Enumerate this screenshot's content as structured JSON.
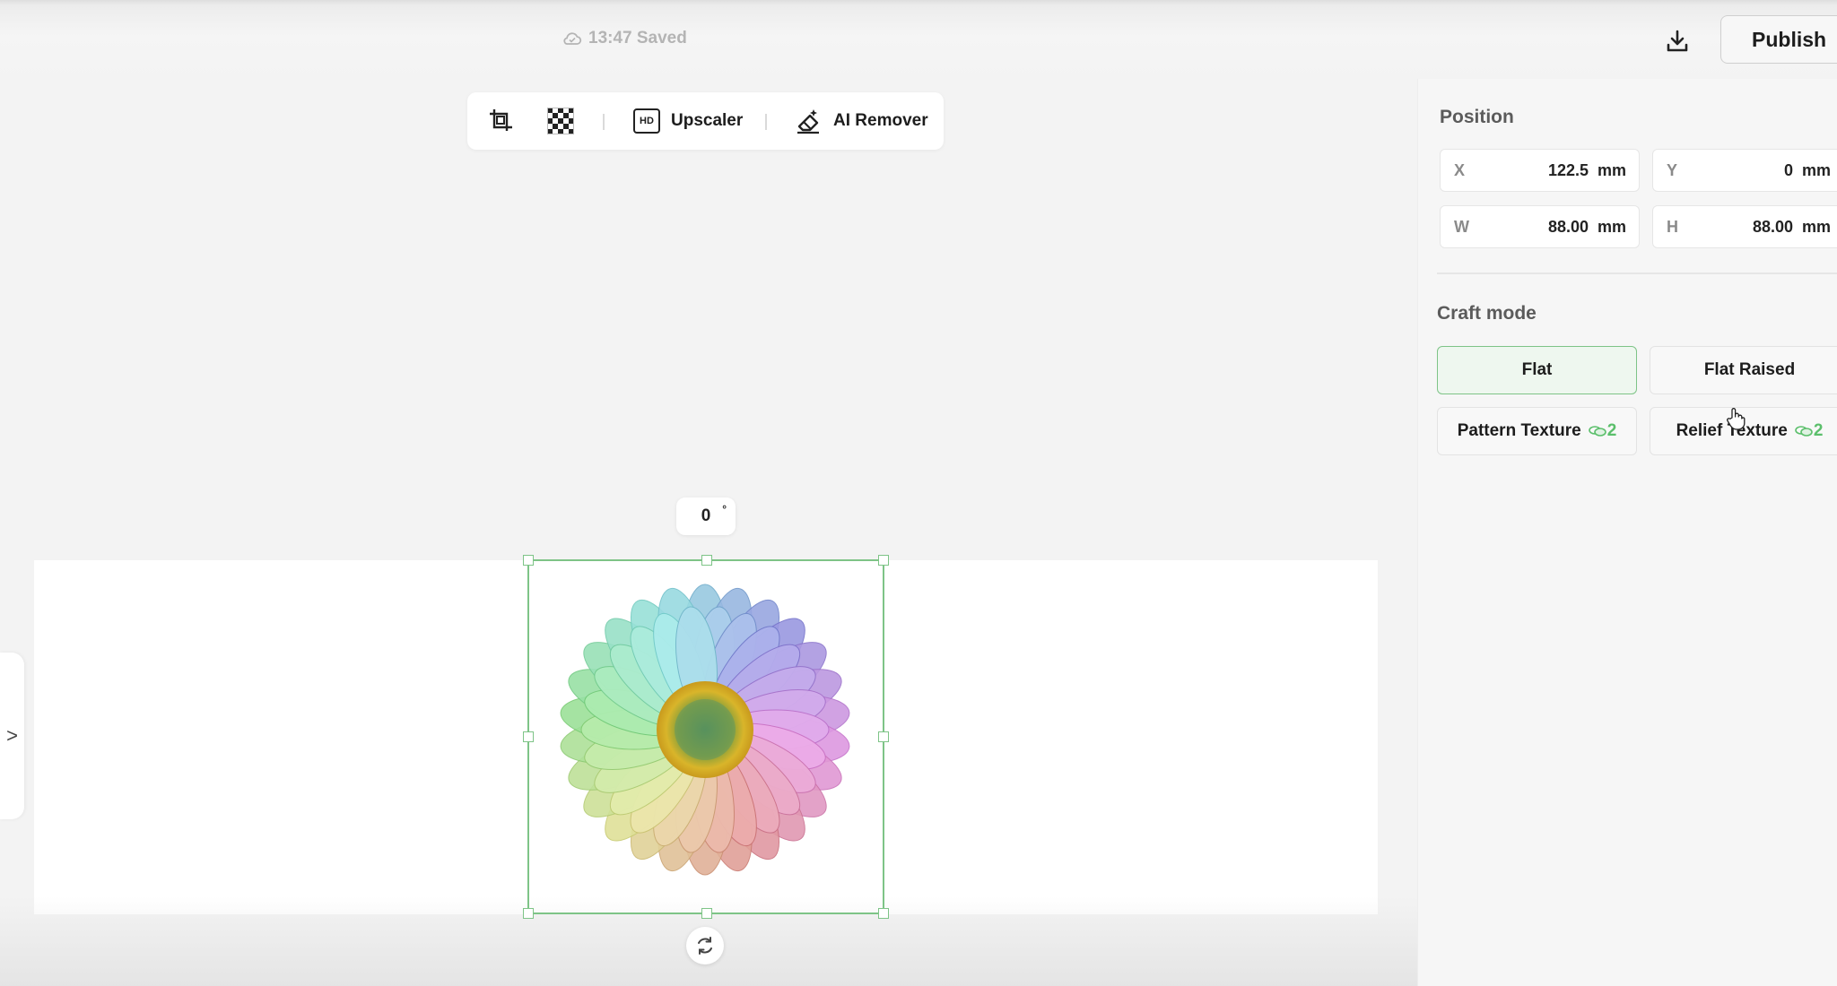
{
  "header": {
    "save_status": "13:47 Saved",
    "publish_label": "Publish",
    "icons": {
      "cloud": "cloud-icon",
      "download": "download-icon"
    }
  },
  "toolbar": {
    "upscaler_label": "Upscaler",
    "upscaler_badge": "HD",
    "ai_remover_label": "AI Remover",
    "icons": [
      "crop-icon",
      "transparency-icon",
      "hd-icon",
      "eraser-icon"
    ]
  },
  "canvas": {
    "rotation_angle": "0",
    "rotation_unit": "°",
    "side_toggle": ">",
    "selected_image": "rainbow-daisy-flower"
  },
  "panel": {
    "position_title": "Position",
    "fields": {
      "x": {
        "label": "X",
        "value": "122.5",
        "unit": "mm"
      },
      "y": {
        "label": "Y",
        "value": "0",
        "unit": "mm"
      },
      "w": {
        "label": "W",
        "value": "88.00",
        "unit": "mm"
      },
      "h": {
        "label": "H",
        "value": "88.00",
        "unit": "mm"
      }
    },
    "craft_mode_title": "Craft mode",
    "craft_modes": [
      {
        "label": "Flat",
        "selected": true
      },
      {
        "label": "Flat Raised",
        "selected": false
      },
      {
        "label": "Pattern Texture",
        "cost": "2",
        "selected": false
      },
      {
        "label": "Relief Texture",
        "cost": "2",
        "selected": false
      }
    ]
  },
  "colors": {
    "accent_green": "#7ec487",
    "coin_green": "#5bbf6b"
  }
}
